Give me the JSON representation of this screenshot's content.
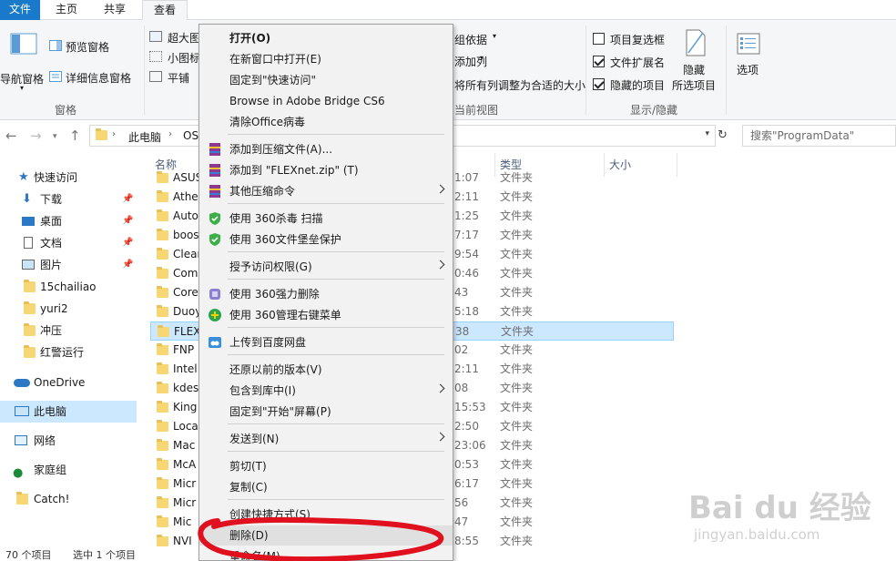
{
  "tabs": {
    "file": "文件",
    "home": "主页",
    "share": "共享",
    "view": "查看"
  },
  "ribbon": {
    "nav_pane": "导航窗格",
    "preview_pane": "预览窗格",
    "details_pane": "详细信息窗格",
    "panes_group": "窗格",
    "extra_large": "超大图",
    "small_icons": "小图标",
    "tiles": "平铺",
    "group_by": "组依据",
    "add_columns": "添加列",
    "size_all_columns": "将所有列调整为合适的大小",
    "current_view": "当前视图",
    "item_checkboxes": "项目复选框",
    "file_extensions": "文件扩展名",
    "hidden_items": "隐藏的项目",
    "item_checkboxes_checked": false,
    "file_extensions_checked": true,
    "hidden_items_checked": true,
    "hide_selected_line1": "隐藏",
    "hide_selected_line2": "所选项目",
    "show_hide_group": "显示/隐藏",
    "options": "选项"
  },
  "address": {
    "this_pc": "此电脑",
    "path_rest": "OS",
    "search_placeholder": "搜索\"ProgramData\""
  },
  "nav_pane": {
    "items": [
      {
        "label": "快速访问",
        "icon": "star-icon"
      },
      {
        "label": "下载",
        "icon": "download-icon"
      },
      {
        "label": "桌面",
        "icon": "desktop-icon"
      },
      {
        "label": "文档",
        "icon": "document-icon"
      },
      {
        "label": "图片",
        "icon": "picture-icon"
      },
      {
        "label": "15chailiao",
        "icon": "folder-icon"
      },
      {
        "label": "yuri2",
        "icon": "folder-icon"
      },
      {
        "label": "冲压",
        "icon": "folder-icon"
      },
      {
        "label": "红警运行",
        "icon": "folder-icon"
      },
      {
        "label": "OneDrive",
        "icon": "cloud-icon"
      },
      {
        "label": "此电脑",
        "icon": "computer-icon"
      },
      {
        "label": "网络",
        "icon": "network-icon"
      },
      {
        "label": "家庭组",
        "icon": "homegroup-icon"
      },
      {
        "label": "Catch!",
        "icon": "folder-icon"
      }
    ]
  },
  "file_list": {
    "headers": {
      "name": "名称",
      "type": "类型",
      "size": "大小"
    },
    "rows": [
      {
        "name": "ASUS",
        "time": "1:07",
        "type": "文件夹"
      },
      {
        "name": "Athe",
        "time": "2:11",
        "type": "文件夹"
      },
      {
        "name": "Auto",
        "time": "1:25",
        "type": "文件夹"
      },
      {
        "name": "boos",
        "time": "7:17",
        "type": "文件夹"
      },
      {
        "name": "Clean",
        "time": "9:54",
        "type": "文件夹"
      },
      {
        "name": "Com",
        "time": "0:46",
        "type": "文件夹"
      },
      {
        "name": "Core",
        "time": "43",
        "type": "文件夹"
      },
      {
        "name": "Duoy",
        "time": "5:18",
        "type": "文件夹"
      },
      {
        "name": "FLEX",
        "time": "38",
        "type": "文件夹"
      },
      {
        "name": "FNP",
        "time": "02",
        "type": "文件夹"
      },
      {
        "name": "Intel",
        "time": "2:11",
        "type": "文件夹"
      },
      {
        "name": "kdes",
        "time": "08",
        "type": "文件夹"
      },
      {
        "name": "King",
        "time": "15:53",
        "type": "文件夹"
      },
      {
        "name": "Loca",
        "time": "2:50",
        "type": "文件夹"
      },
      {
        "name": "Mac",
        "time": "23:06",
        "type": "文件夹"
      },
      {
        "name": "McA",
        "time": "0:53",
        "type": "文件夹"
      },
      {
        "name": "Micr",
        "time": "6:17",
        "type": "文件夹"
      },
      {
        "name": "Micr",
        "time": "56",
        "type": "文件夹"
      },
      {
        "name": "Mic",
        "time": "47",
        "type": "文件夹"
      },
      {
        "name": "NVI",
        "time": "8:55",
        "type": "文件夹"
      }
    ]
  },
  "context_menu": {
    "items": [
      "打开(O)",
      "在新窗口中打开(E)",
      "固定到\"快速访问\"",
      "Browse in Adobe Bridge CS6",
      "清除Office病毒",
      "添加到压缩文件(A)...",
      "添加到 \"FLEXnet.zip\" (T)",
      "其他压缩命令",
      "使用 360杀毒 扫描",
      "使用 360文件堡垒保护",
      "授予访问权限(G)",
      "使用 360强力删除",
      "使用 360管理右键菜单",
      "上传到百度网盘",
      "还原以前的版本(V)",
      "包含到库中(I)",
      "固定到\"开始\"屏幕(P)",
      "发送到(N)",
      "剪切(T)",
      "复制(C)",
      "创建快捷方式(S)",
      "删除(D)",
      "重命名(M)"
    ]
  },
  "status_bar": {
    "count": "70 个项目",
    "selected": "选中 1 个项目"
  },
  "colors": {
    "file_tab": "#1979ca",
    "selection": "#cce8ff",
    "annotation": "#e0101e"
  },
  "watermark": {
    "brand": "Bai du 经验",
    "url": "jingyan.baidu.com"
  }
}
